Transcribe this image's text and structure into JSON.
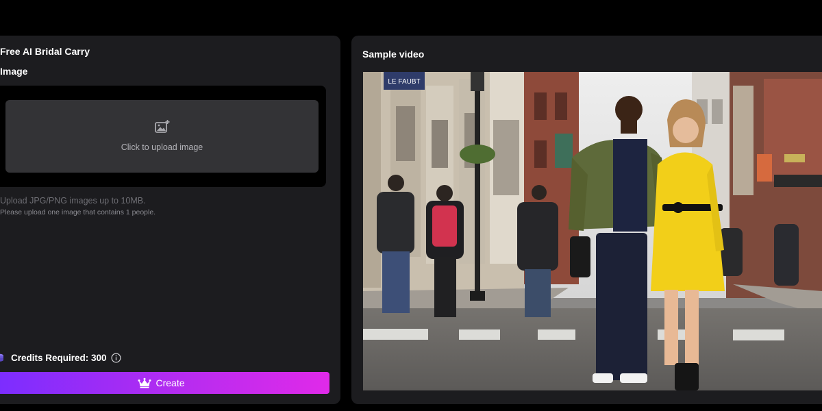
{
  "form": {
    "title": "Free AI Bridal Carry",
    "image_section_label": "Image",
    "upload_text": "Click to upload image",
    "upload_icon": "image-plus-icon",
    "hint_main": "Upload JPG/PNG images up to 10MB.",
    "hint_sub": "Please upload one image that contains 1 people.",
    "credits_label": "Credits Required: 300",
    "credits_icon": "coin-stack-icon",
    "info_icon": "info-icon",
    "create_label": "Create",
    "create_icon": "crown-icon"
  },
  "sample": {
    "title": "Sample video",
    "street_sign": "LE FAUBT"
  },
  "colors": {
    "background": "#000000",
    "panel": "#1c1c1f",
    "upload_box": "#333336",
    "accent_gradient_start": "#7a2dff",
    "accent_gradient_end": "#e02ae9",
    "jacket": "#5e6a3a",
    "dress": "#f2cf19"
  }
}
